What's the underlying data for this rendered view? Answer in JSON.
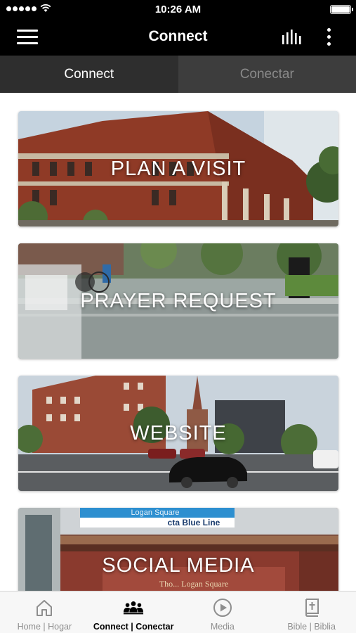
{
  "status_bar": {
    "time": "10:26 AM"
  },
  "nav": {
    "title": "Connect",
    "menu_icon": "hamburger-menu-icon",
    "bars_icon": "audio-bars-icon",
    "more_icon": "more-vertical-icon"
  },
  "tabs": [
    {
      "label": "Connect",
      "active": true
    },
    {
      "label": "Conectar",
      "active": false
    }
  ],
  "cards": [
    {
      "label": "PLAN A VISIT"
    },
    {
      "label": "PRAYER REQUEST"
    },
    {
      "label": "WEBSITE"
    },
    {
      "label": "SOCIAL MEDIA"
    }
  ],
  "photo_text": {
    "sign_line": "cta Blue Line",
    "sign_top": "Logan Square",
    "window_text": "Tho... Logan Square"
  },
  "tab_bar": [
    {
      "label": "Home | Hogar",
      "icon": "home-icon"
    },
    {
      "label": "Connect | Conectar",
      "icon": "people-group-icon",
      "active": true
    },
    {
      "label": "Media",
      "icon": "play-circle-icon"
    },
    {
      "label": "Bible | Biblia",
      "icon": "bible-book-icon"
    }
  ]
}
